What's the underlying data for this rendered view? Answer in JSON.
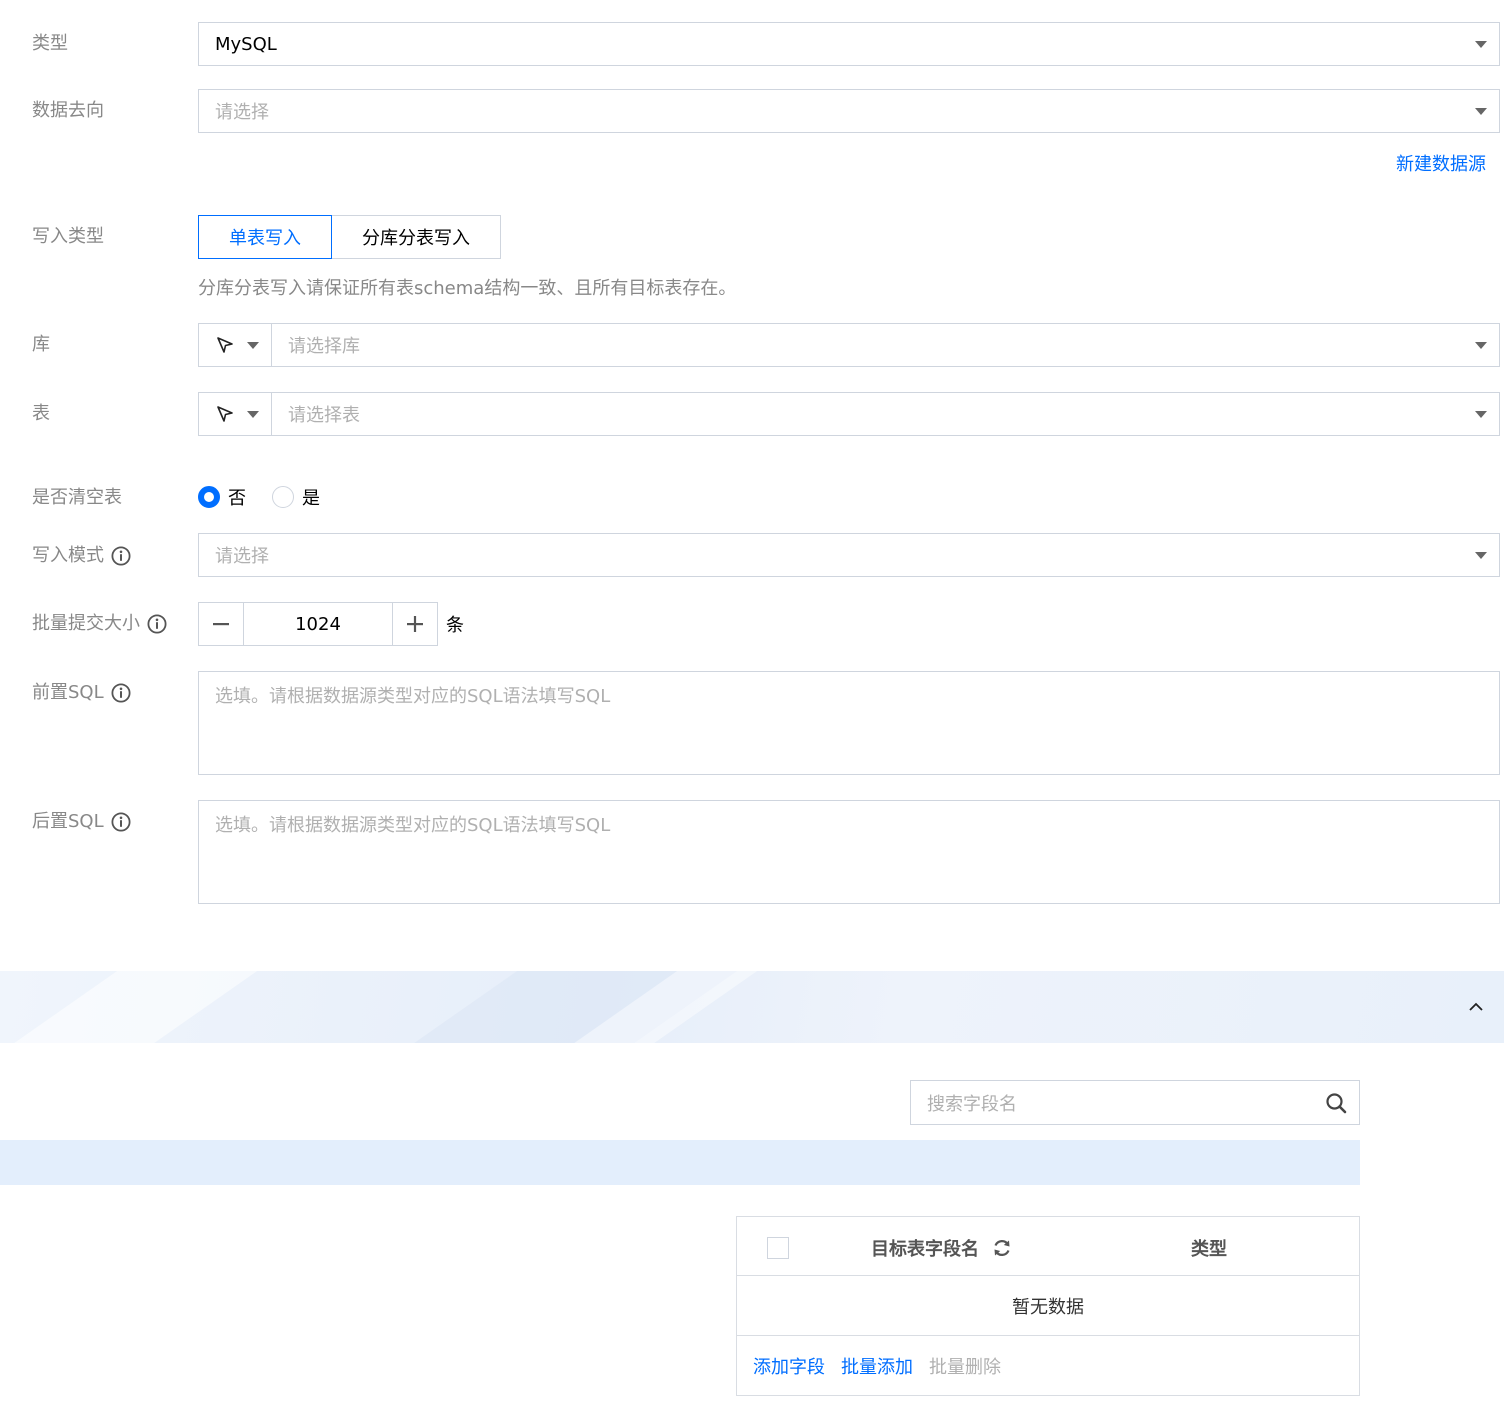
{
  "form": {
    "type": {
      "label": "类型",
      "value": "MySQL"
    },
    "data_direction": {
      "label": "数据去向",
      "placeholder": "请选择"
    },
    "new_datasource_link": "新建数据源",
    "write_type": {
      "label": "写入类型",
      "options": [
        "单表写入",
        "分库分表写入"
      ],
      "selected": "单表写入",
      "hint": "分库分表写入请保证所有表schema结构一致、且所有目标表存在。"
    },
    "database": {
      "label": "库",
      "placeholder": "请选择库"
    },
    "table": {
      "label": "表",
      "placeholder": "请选择表"
    },
    "truncate": {
      "label": "是否清空表",
      "options": [
        "否",
        "是"
      ],
      "selected": "否"
    },
    "write_mode": {
      "label": "写入模式",
      "placeholder": "请选择"
    },
    "batch_size": {
      "label": "批量提交大小",
      "value": "1024",
      "unit": "条"
    },
    "pre_sql": {
      "label": "前置SQL",
      "placeholder": "选填。请根据数据源类型对应的SQL语法填写SQL"
    },
    "post_sql": {
      "label": "后置SQL",
      "placeholder": "选填。请根据数据源类型对应的SQL语法填写SQL"
    }
  },
  "fields": {
    "search_placeholder": "搜索字段名",
    "table": {
      "col_name": "目标表字段名",
      "col_type": "类型",
      "empty_text": "暂无数据"
    },
    "actions": {
      "add": "添加字段",
      "batch_add": "批量添加",
      "batch_delete": "批量删除"
    }
  },
  "colors": {
    "accent": "#006eff",
    "border": "#cfd5de",
    "label": "#888888",
    "band": "#e3eefc"
  },
  "icons": [
    "caret-down-icon",
    "cursor-icon",
    "info-icon",
    "minus-icon",
    "plus-icon",
    "chevron-up-icon",
    "search-icon",
    "refresh-icon"
  ]
}
